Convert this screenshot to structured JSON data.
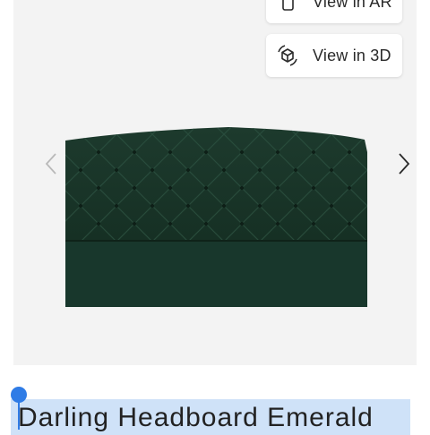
{
  "viewer": {
    "ar_label": "View in AR",
    "threed_label": "View in 3D",
    "ar_icon": "ar-phone-icon",
    "threed_icon": "cube-3d-icon",
    "prev_icon": "chevron-left-icon",
    "next_icon": "chevron-right-icon"
  },
  "product": {
    "title": "Darling Headboard Emerald",
    "color": "#1f3d30"
  },
  "selection": {
    "color": "#cfe2f8",
    "handle_color": "#2f7ce6"
  }
}
